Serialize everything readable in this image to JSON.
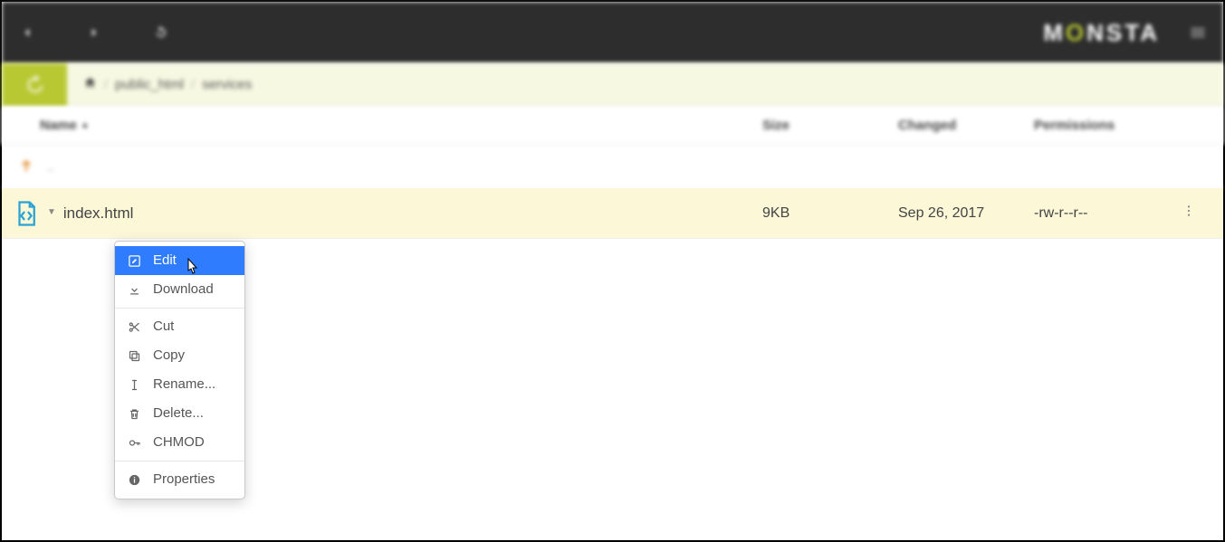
{
  "brand": "MONSTA",
  "breadcrumb": {
    "items": [
      "public_html",
      "services"
    ]
  },
  "columns": {
    "name": "Name",
    "size": "Size",
    "changed": "Changed",
    "permissions": "Permissions"
  },
  "parent": {
    "label": ".."
  },
  "file": {
    "name": "index.html",
    "size": "9KB",
    "changed": "Sep 26, 2017",
    "permissions": "-rw-r--r--"
  },
  "context_menu": {
    "edit": "Edit",
    "download": "Download",
    "cut": "Cut",
    "copy": "Copy",
    "rename": "Rename...",
    "delete": "Delete...",
    "chmod": "CHMOD",
    "properties": "Properties"
  }
}
